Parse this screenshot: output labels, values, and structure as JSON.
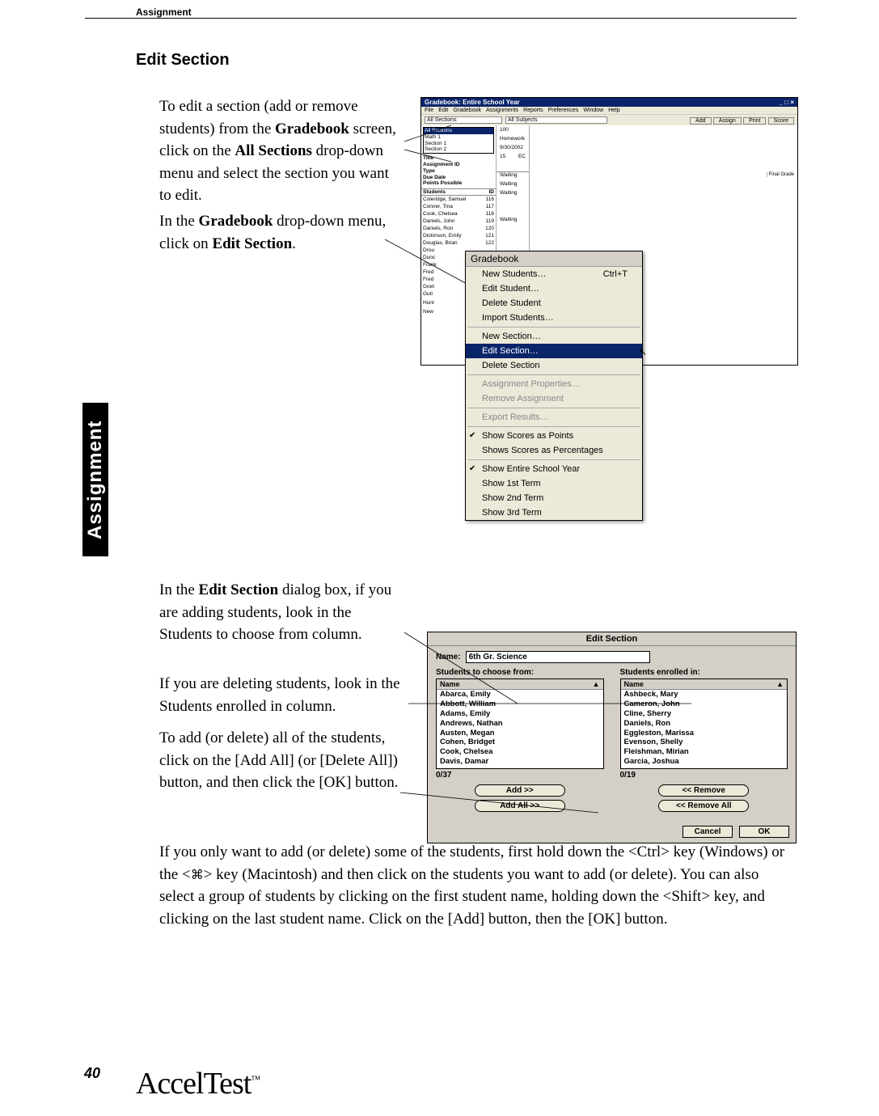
{
  "header": {
    "topic": "Assignment"
  },
  "sideTab": "Assignment",
  "heading": "Edit Section",
  "pageNumber": "40",
  "logo": "AccelTest",
  "logoTM": "™",
  "para1_parts": [
    "To edit a section (add or remove students) from the ",
    "Gradebook",
    " screen, click on the ",
    "All Sections",
    " drop-down menu and select the section you want to edit."
  ],
  "para2_parts": [
    "In the ",
    "Gradebook",
    " drop-down menu, click on ",
    "Edit Section",
    "."
  ],
  "para3_parts": [
    "In the ",
    "Edit Section",
    " dialog box, if you are adding students, look in the Students to choose from column."
  ],
  "para4": "If you are deleting students, look in the Students enrolled in column.",
  "para5": "To add (or delete) all of the students, click on the [Add All] (or [Delete All]) button, and then click the [OK] button.",
  "para6_parts": [
    "If you only want to add (or delete) some of the students, first hold down the <Ctrl> key (Windows) or the <",
    "⌘",
    "> key (Macintosh) and then click on the students you want to add (or delete). You can also select a group of students by clicking on the first student name, holding down the <Shift> key, and clicking on the last student name. Click on the [Add] button, then the [OK] button."
  ],
  "shot1": {
    "title": "Gradebook: Entire School Year",
    "windowButtons": "_ □ ×",
    "menus": [
      "File",
      "Edit",
      "Gradebook",
      "Assignments",
      "Reports",
      "Preferences",
      "Window",
      "Help"
    ],
    "sectionsDD": [
      "All Sections",
      "Math 1",
      "Section 1",
      "Section 2"
    ],
    "subjectsDD": "All Subjects",
    "toolbarButtons": [
      "Add",
      "Assign",
      "Print",
      "Score"
    ],
    "meta": {
      "titleLbl": "Title",
      "assignmentIdLbl": "Assignment ID",
      "typeLbl": "Type",
      "dueDateLbl": "Due Date",
      "pointsLbl": "Points Possible",
      "assignmentId": "100",
      "type": "Homework",
      "dueDate": "9/30/2002",
      "points": "15",
      "ec": "EC"
    },
    "studentsHdr": {
      "name": "Students",
      "id": "ID"
    },
    "finalGradeHdr": "Final Grade",
    "students": [
      {
        "name": "Coleridge, Samuel",
        "id": "116",
        "status": "Waiting"
      },
      {
        "name": "Conner, Tina",
        "id": "117",
        "status": "Waiting"
      },
      {
        "name": "Cook, Chelsea",
        "id": "118",
        "status": "Waiting"
      },
      {
        "name": "Daniels, John",
        "id": "119",
        "status": ""
      },
      {
        "name": "Daniels, Ron",
        "id": "120",
        "status": ""
      },
      {
        "name": "Dickinson, Emily",
        "id": "121",
        "status": "Waiting"
      },
      {
        "name": "Douglas, Brian",
        "id": "122",
        "status": ""
      }
    ],
    "partialNames": [
      "Drou",
      "Dunc",
      "Frank",
      "Fred",
      "Fred",
      "Goet",
      "Guti",
      "",
      "Hunt",
      "",
      "New"
    ]
  },
  "gbMenu": {
    "title": "Gradebook",
    "items": [
      {
        "label": "New Students…",
        "shortcut": "Ctrl+T",
        "enabled": true
      },
      {
        "label": "Edit Student…",
        "enabled": true
      },
      {
        "label": "Delete Student",
        "enabled": true
      },
      {
        "label": "Import Students…",
        "enabled": true
      },
      {
        "sep": true
      },
      {
        "label": "New Section…",
        "enabled": true
      },
      {
        "label": "Edit Section…",
        "enabled": true,
        "highlight": true
      },
      {
        "label": "Delete Section",
        "enabled": true
      },
      {
        "sep": true
      },
      {
        "label": "Assignment Properties…",
        "enabled": false
      },
      {
        "label": "Remove Assignment",
        "enabled": false
      },
      {
        "sep": true
      },
      {
        "label": "Export Results…",
        "enabled": false
      },
      {
        "sep": true
      },
      {
        "label": "Show Scores as Points",
        "enabled": true,
        "checked": true
      },
      {
        "label": "Shows Scores as Percentages",
        "enabled": true
      },
      {
        "sep": true
      },
      {
        "label": "Show Entire School Year",
        "enabled": true,
        "checked": true
      },
      {
        "label": "Show 1st Term",
        "enabled": true
      },
      {
        "label": "Show 2nd Term",
        "enabled": true
      },
      {
        "label": "Show 3rd Term",
        "enabled": true
      }
    ]
  },
  "shot2": {
    "title": "Edit Section",
    "nameLabel": "Name:",
    "nameValue": "6th Gr. Science",
    "leftCaption": "Students to choose from:",
    "rightCaption": "Students enrolled in:",
    "colHdr": "Name",
    "sortIcon": "▲",
    "leftList": [
      "Abarca, Emily",
      "Abbott, William",
      "Adams, Emily",
      "Andrews, Nathan",
      "Austen, Megan",
      "Cohen, Bridget",
      "Cook, Chelsea",
      "Davis, Damar"
    ],
    "rightList": [
      "Ashbeck, Mary",
      "Cameron, John",
      "Cline, Sherry",
      "Daniels, Ron",
      "Eggleston, Marissa",
      "Evenson, Shelly",
      "Fleishman, Mirian",
      "Garcia, Joshua"
    ],
    "leftCount": "0/37",
    "rightCount": "0/19",
    "addBtn": "Add >>",
    "addAllBtn": "Add All >>",
    "removeBtn": "<< Remove",
    "removeAllBtn": "<< Remove All",
    "cancelBtn": "Cancel",
    "okBtn": "OK"
  }
}
